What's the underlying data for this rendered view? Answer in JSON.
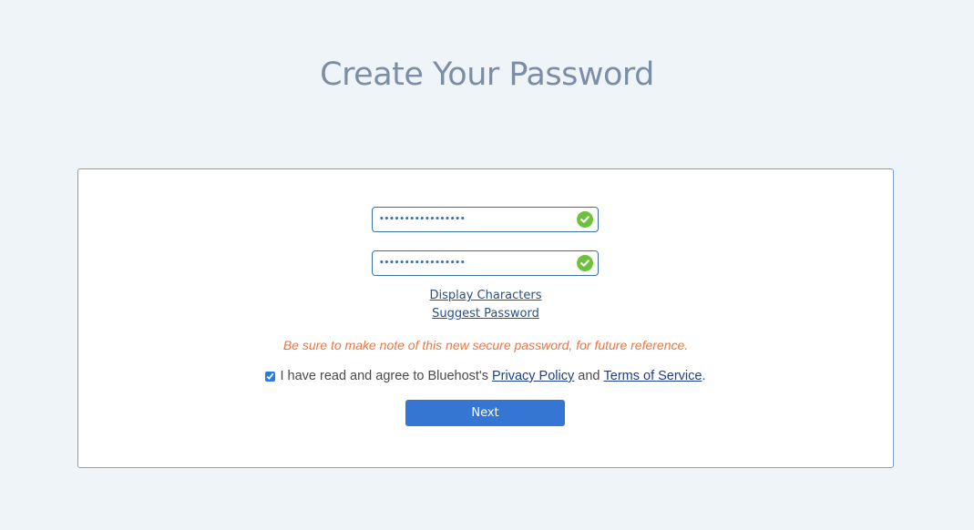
{
  "page": {
    "title": "Create Your Password"
  },
  "form": {
    "password": {
      "value": "•••••••••••••••••",
      "valid": true,
      "status_icon": "check-circle-icon"
    },
    "confirm_password": {
      "value": "•••••••••••••••••",
      "valid": true,
      "status_icon": "check-circle-icon"
    },
    "display_characters_link": "Display Characters",
    "suggest_password_link": "Suggest Password",
    "note": "Be sure to make note of this new secure password, for future reference.",
    "agreement": {
      "checked": true,
      "text_before": "I have read and agree to Bluehost's",
      "privacy_policy_link": "Privacy Policy",
      "and_text": "and",
      "terms_link": "Terms of Service",
      "period": "."
    },
    "next_button": "Next"
  },
  "colors": {
    "background": "#eff4f9",
    "title": "#7b8ea5",
    "valid_check": "#6fc13b",
    "note": "#ee7540",
    "primary_button": "#3575d3",
    "link": "#2a4f88"
  }
}
